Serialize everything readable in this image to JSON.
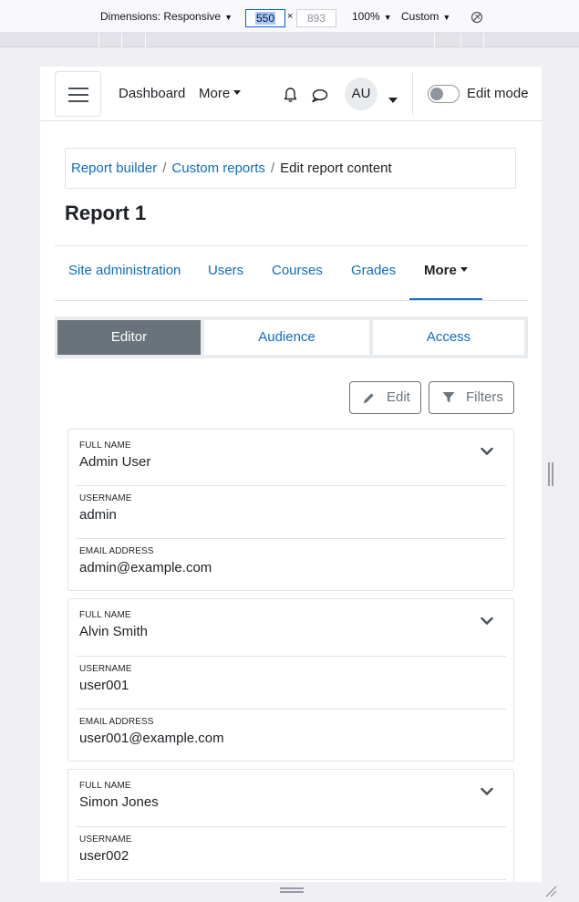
{
  "devtools": {
    "dimensions_label": "Dimensions: Responsive",
    "width": "550",
    "times": "×",
    "height": "893",
    "zoom": "100%",
    "throttle": "Custom"
  },
  "navbar": {
    "links": [
      "Dashboard",
      "More"
    ],
    "avatar_initials": "AU",
    "edit_mode_label": "Edit mode",
    "edit_mode_on": false
  },
  "breadcrumb": {
    "items": [
      "Report builder",
      "Custom reports"
    ],
    "separator": "/",
    "current": "Edit report content"
  },
  "page_title": "Report 1",
  "secondary_nav": {
    "tabs": [
      "Site administration",
      "Users",
      "Courses",
      "Grades",
      "More"
    ],
    "active": "More"
  },
  "report_tabs": {
    "tabs": [
      "Editor",
      "Audience",
      "Access"
    ],
    "active": "Editor"
  },
  "actions": {
    "edit_label": "Edit",
    "filters_label": "Filters"
  },
  "columns": [
    "FULL NAME",
    "USERNAME",
    "EMAIL ADDRESS"
  ],
  "rows": [
    {
      "fullname": "Admin User",
      "username": "admin",
      "email": "admin@example.com"
    },
    {
      "fullname": "Alvin Smith",
      "username": "user001",
      "email": "user001@example.com"
    },
    {
      "fullname": "Simon Jones",
      "username": "user002",
      "email": ""
    }
  ],
  "colors": {
    "link": "#0f6cbf",
    "active_tab_bg": "#6a737b",
    "border": "#dee2e6"
  }
}
